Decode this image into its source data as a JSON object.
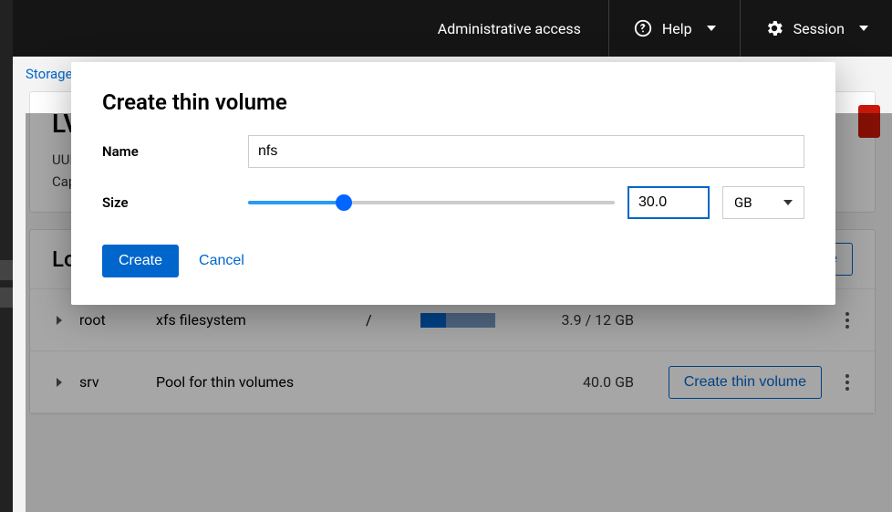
{
  "topbar": {
    "admin_access": "Administrative access",
    "help": "Help",
    "session": "Session"
  },
  "breadcrumb": {
    "storage": "Storage"
  },
  "lv_panel": {
    "title_prefix": "LV",
    "uuid_label": "UUI",
    "cap_label": "Cap"
  },
  "logical_volumes": {
    "title": "Logical volumes",
    "create_new_label": "Create new logical volume",
    "rows": [
      {
        "name": "root",
        "desc": "xfs filesystem",
        "mount": "/",
        "usage_fill_pct": 34,
        "usage_text": "3.9 / 12 GB",
        "action_label": ""
      },
      {
        "name": "srv",
        "desc": "Pool for thin volumes",
        "mount": "",
        "usage_fill_pct": 0,
        "usage_text": "40.0 GB",
        "action_label": "Create thin volume"
      }
    ]
  },
  "modal": {
    "title": "Create thin volume",
    "name_label": "Name",
    "name_value": "nfs",
    "size_label": "Size",
    "size_value": "30.0",
    "unit_value": "GB",
    "create_label": "Create",
    "cancel_label": "Cancel"
  }
}
